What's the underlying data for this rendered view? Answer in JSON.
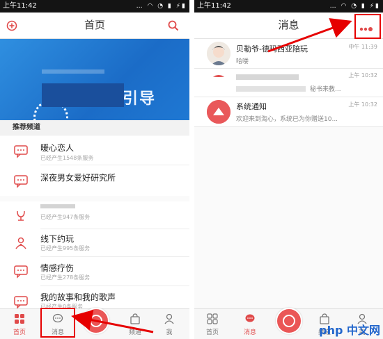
{
  "left": {
    "status_time": "上午11:42",
    "title": "首页",
    "section_title": "推荐频道",
    "channels": [
      {
        "name": "暖心恋人",
        "sub": "已经产生1548条服务"
      },
      {
        "name": "深夜男女爱好研究所",
        "sub": ""
      },
      {
        "name": "",
        "sub": "已经产生947条服务"
      },
      {
        "name": "线下约玩",
        "sub": "已经产生995条服务"
      },
      {
        "name": "情感疗伤",
        "sub": "已经产生278条服务"
      },
      {
        "name": "我的故事和我的歌声",
        "sub": "已经产生0条服务"
      }
    ],
    "tabs": [
      {
        "label": "首页"
      },
      {
        "label": "消息"
      },
      {
        "label": "频道"
      },
      {
        "label": "我"
      }
    ]
  },
  "right": {
    "status_time": "上午11:42",
    "title": "消息",
    "messages": [
      {
        "name": "贝勒爷-德玛西亚陪玩",
        "preview": "哈喽",
        "time": "中午 11:39"
      },
      {
        "name": "",
        "preview": "秘书来教...",
        "time": "上午 10:32"
      },
      {
        "name": "系统通知",
        "preview": "欢迎来到淘心，系统已为你赠送10...",
        "time": "上午 10:32"
      }
    ],
    "tabs": [
      {
        "label": "首页"
      },
      {
        "label": "消息"
      },
      {
        "label": "频道"
      },
      {
        "label": "我"
      }
    ]
  },
  "banner_text": "引导",
  "watermark": "php 中文网",
  "colors": {
    "accent": "#e04a4a",
    "annotation_red": "#e60000",
    "banner_blue": "#1b6cc7"
  },
  "icons": {
    "add": "add-circle-icon",
    "search": "search-icon",
    "more": "more-dots-icon",
    "channel": "chat-bubble-icon"
  }
}
